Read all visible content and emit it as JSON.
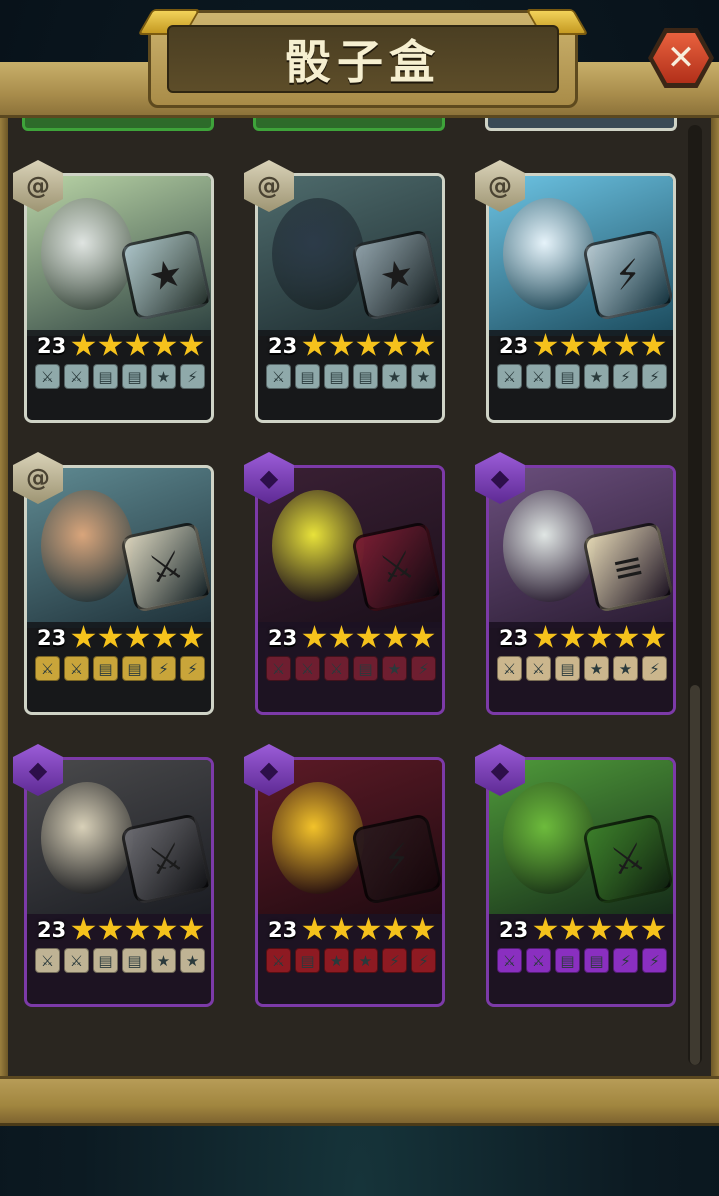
{
  "title": "骰子盒",
  "close_icon": "close-icon",
  "colors": {
    "wood": "#a98d4c",
    "panel": "#2a2620",
    "star": "#f5c21c",
    "common_border": "#cfd3c6",
    "epic_border": "#7c3aa8"
  },
  "scroll": {
    "position": 1.0
  },
  "cards": [
    {
      "id": "ghoul",
      "rarity": "common",
      "level": "23",
      "stars": 5,
      "art": {
        "bg": [
          "#b9d4a6",
          "#2d4140"
        ],
        "char": "#dfe4e1",
        "die_bg": "#a9c1c6",
        "die_icon": "★"
      },
      "faces": [
        {
          "icon": "sword",
          "bg": "#8fa9aa"
        },
        {
          "icon": "sword",
          "bg": "#8fa9aa"
        },
        {
          "icon": "shield",
          "bg": "#8fa9aa"
        },
        {
          "icon": "shield",
          "bg": "#8fa9aa"
        },
        {
          "icon": "star",
          "bg": "#8fa9aa"
        },
        {
          "icon": "lightning",
          "bg": "#8fa9aa"
        }
      ]
    },
    {
      "id": "knight",
      "rarity": "common",
      "level": "23",
      "stars": 5,
      "art": {
        "bg": [
          "#4f6c6d",
          "#1c2a2e"
        ],
        "char": "#2c3b49",
        "die_bg": "#8fa0a8",
        "die_icon": "★"
      },
      "faces": [
        {
          "icon": "sword",
          "bg": "#8fa9aa"
        },
        {
          "icon": "shield",
          "bg": "#8fa9aa"
        },
        {
          "icon": "shield",
          "bg": "#8fa9aa"
        },
        {
          "icon": "shield",
          "bg": "#8fa9aa"
        },
        {
          "icon": "star",
          "bg": "#8fa9aa"
        },
        {
          "icon": "star",
          "bg": "#8fa9aa"
        }
      ]
    },
    {
      "id": "yeti",
      "rarity": "common",
      "level": "23",
      "stars": 5,
      "art": {
        "bg": [
          "#6cc3e3",
          "#1b4a5c"
        ],
        "char": "#e6f3fa",
        "die_bg": "#b4c7cf",
        "die_icon": "⚡"
      },
      "faces": [
        {
          "icon": "sword",
          "bg": "#8fa9aa"
        },
        {
          "icon": "sword",
          "bg": "#8fa9aa"
        },
        {
          "icon": "shield",
          "bg": "#8fa9aa"
        },
        {
          "icon": "star",
          "bg": "#8fa9aa"
        },
        {
          "icon": "lightning",
          "bg": "#8fa9aa"
        },
        {
          "icon": "lightning",
          "bg": "#8fa9aa"
        }
      ]
    },
    {
      "id": "wizard",
      "rarity": "common",
      "level": "23",
      "stars": 5,
      "art": {
        "bg": [
          "#5f8a92",
          "#1e3038"
        ],
        "char": "#d9a57b",
        "die_bg": "#d8d2bb",
        "die_icon": "⚔"
      },
      "faces": [
        {
          "icon": "sword",
          "bg": "#c9a53a"
        },
        {
          "icon": "sword",
          "bg": "#c9a53a"
        },
        {
          "icon": "shield",
          "bg": "#c9a53a"
        },
        {
          "icon": "shield",
          "bg": "#c9a53a"
        },
        {
          "icon": "lightning",
          "bg": "#c9a53a"
        },
        {
          "icon": "lightning",
          "bg": "#c9a53a"
        }
      ]
    },
    {
      "id": "eye",
      "rarity": "epic",
      "level": "23",
      "stars": 5,
      "art": {
        "bg": [
          "#3a2034",
          "#1a0f1a"
        ],
        "char": "#e8e23a",
        "die_bg": "#7a1e33",
        "die_icon": "⚔"
      },
      "faces": [
        {
          "icon": "sword",
          "bg": "#6e1e30"
        },
        {
          "icon": "sword",
          "bg": "#6e1e30"
        },
        {
          "icon": "sword",
          "bg": "#6e1e30"
        },
        {
          "icon": "shield",
          "bg": "#6e1e30"
        },
        {
          "icon": "star",
          "bg": "#6e1e30"
        },
        {
          "icon": "lightning",
          "bg": "#6e1e30"
        }
      ]
    },
    {
      "id": "skeleton",
      "rarity": "epic",
      "level": "23",
      "stars": 5,
      "art": {
        "bg": [
          "#6a4e7c",
          "#2a1c32"
        ],
        "char": "#e0e6e4",
        "die_bg": "#e1d5b2",
        "die_icon": "≡"
      },
      "faces": [
        {
          "icon": "sword",
          "bg": "#cbb68d"
        },
        {
          "icon": "sword",
          "bg": "#cbb68d"
        },
        {
          "icon": "shield",
          "bg": "#cbb68d"
        },
        {
          "icon": "star",
          "bg": "#cbb68d"
        },
        {
          "icon": "star",
          "bg": "#cbb68d"
        },
        {
          "icon": "lightning",
          "bg": "#cbb68d"
        }
      ]
    },
    {
      "id": "spider",
      "rarity": "epic",
      "level": "23",
      "stars": 5,
      "art": {
        "bg": [
          "#4a4a4c",
          "#1a1c22"
        ],
        "char": "#d8d0b8",
        "die_bg": "#6a6a70",
        "die_icon": "⚔"
      },
      "faces": [
        {
          "icon": "sword",
          "bg": "#bfb394"
        },
        {
          "icon": "sword",
          "bg": "#bfb394"
        },
        {
          "icon": "shield",
          "bg": "#bfb394"
        },
        {
          "icon": "shield",
          "bg": "#bfb394"
        },
        {
          "icon": "star",
          "bg": "#bfb394"
        },
        {
          "icon": "star",
          "bg": "#bfb394"
        }
      ]
    },
    {
      "id": "vampire",
      "rarity": "epic",
      "level": "23",
      "stars": 5,
      "art": {
        "bg": [
          "#5c1a26",
          "#1e0a10"
        ],
        "char": "#f2c22a",
        "die_bg": "#2b1a1e",
        "die_icon": "⚡"
      },
      "faces": [
        {
          "icon": "sword",
          "bg": "#8e1a22"
        },
        {
          "icon": "shield",
          "bg": "#8e1a22"
        },
        {
          "icon": "star",
          "bg": "#8e1a22"
        },
        {
          "icon": "star",
          "bg": "#8e1a22"
        },
        {
          "icon": "lightning",
          "bg": "#8e1a22"
        },
        {
          "icon": "lightning",
          "bg": "#8e1a22"
        }
      ]
    },
    {
      "id": "witch",
      "rarity": "epic",
      "level": "23",
      "stars": 5,
      "art": {
        "bg": [
          "#4f9a3a",
          "#142a18"
        ],
        "char": "#6dbb3c",
        "die_bg": "#3b7d2a",
        "die_icon": "⚔"
      },
      "faces": [
        {
          "icon": "sword",
          "bg": "#8a2fc0"
        },
        {
          "icon": "sword",
          "bg": "#8a2fc0"
        },
        {
          "icon": "shield",
          "bg": "#8a2fc0"
        },
        {
          "icon": "shield",
          "bg": "#8a2fc0"
        },
        {
          "icon": "lightning",
          "bg": "#8a2fc0"
        },
        {
          "icon": "lightning",
          "bg": "#8a2fc0"
        }
      ]
    }
  ]
}
